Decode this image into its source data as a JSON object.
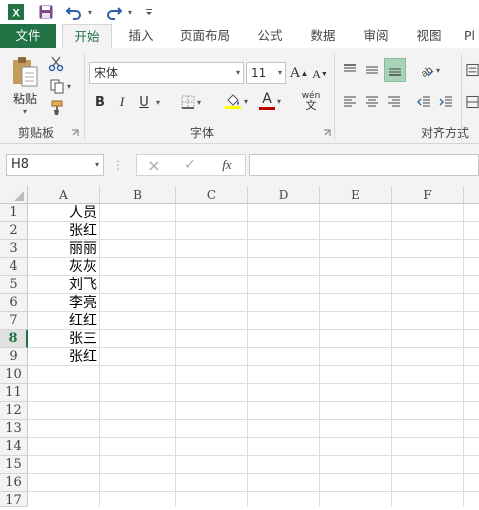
{
  "qat": {
    "excel_icon": "excel-logo-icon",
    "save_icon": "save-icon",
    "undo_icon": "undo-icon",
    "redo_icon": "redo-icon",
    "customize_icon": "customize-qat-icon"
  },
  "tabs": [
    {
      "label": "文件"
    },
    {
      "label": "开始"
    },
    {
      "label": "插入"
    },
    {
      "label": "页面布局"
    },
    {
      "label": "公式"
    },
    {
      "label": "数据"
    },
    {
      "label": "审阅"
    },
    {
      "label": "视图"
    },
    {
      "label": "Pl"
    }
  ],
  "ribbon": {
    "clipboard": {
      "paste_label": "粘贴",
      "group_label": "剪贴板"
    },
    "font": {
      "font_name": "宋体",
      "font_size": "11",
      "grow_label": "A",
      "shrink_label": "A",
      "bold_label": "B",
      "italic_label": "I",
      "underline_label": "U",
      "fontcolor_label": "A",
      "wen_label": "wén",
      "wen_sub": "文",
      "group_label": "字体"
    },
    "alignment": {
      "group_label": "对齐方式"
    }
  },
  "formula_bar": {
    "name_box": "H8",
    "cancel_icon": "×",
    "enter_icon": "✓",
    "fx_label": "fx",
    "formula_value": ""
  },
  "sheet": {
    "columns": [
      "A",
      "B",
      "C",
      "D",
      "E",
      "F"
    ],
    "rows": [
      "1",
      "2",
      "3",
      "4",
      "5",
      "6",
      "7",
      "8",
      "9",
      "10",
      "11",
      "12",
      "13",
      "14",
      "15",
      "16",
      "17"
    ],
    "selected_row": "8",
    "col_a": [
      "人员",
      "张红",
      "丽丽",
      "灰灰",
      "刘飞",
      "李亮",
      "红红",
      "张三",
      "张红"
    ]
  },
  "colors": {
    "accent": "#217346",
    "font_color_bar": "#c00000",
    "fill_color_bar": "#ffff00"
  }
}
